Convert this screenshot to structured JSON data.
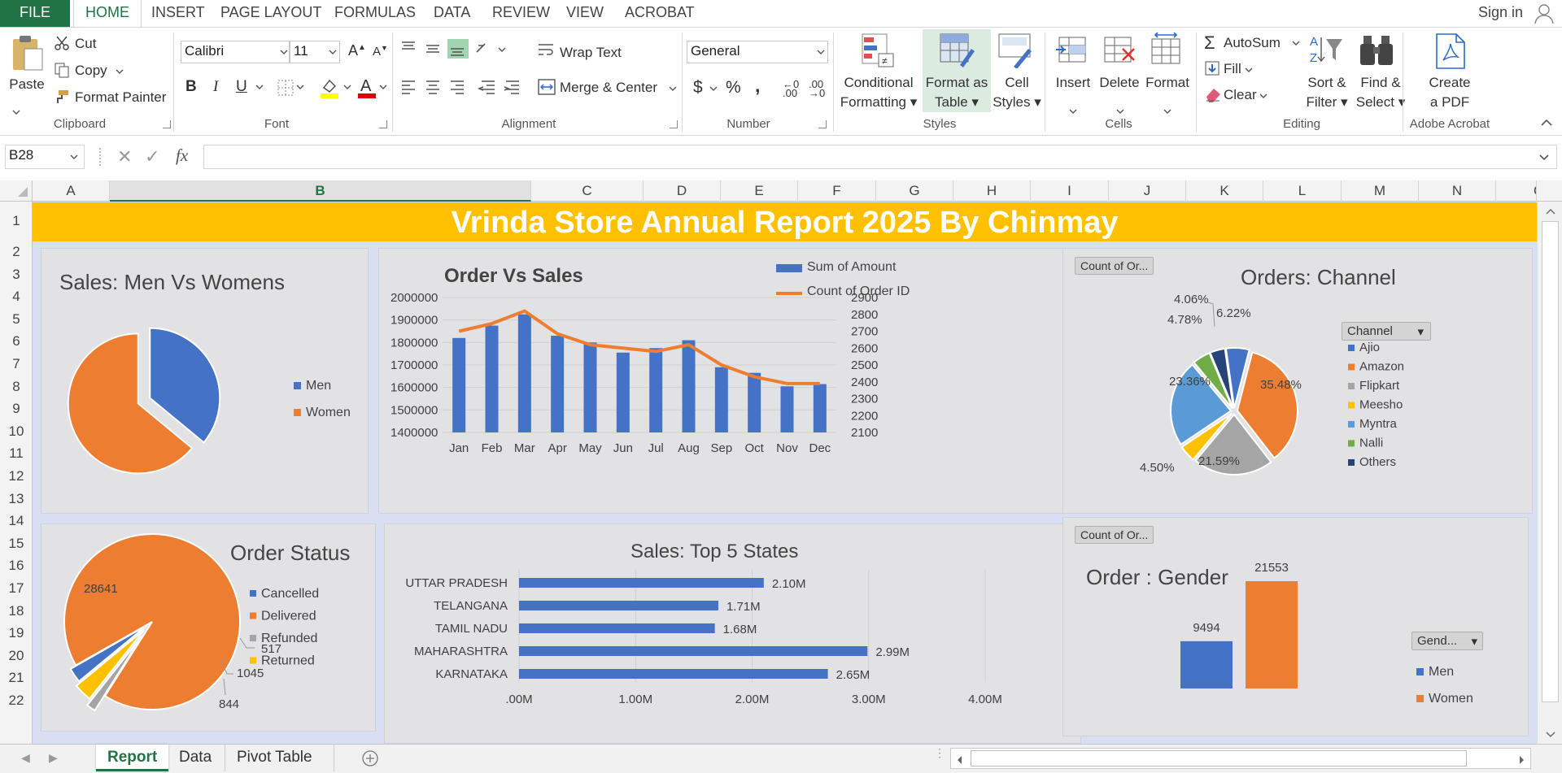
{
  "ribbon_tabs": [
    "FILE",
    "HOME",
    "INSERT",
    "PAGE LAYOUT",
    "FORMULAS",
    "DATA",
    "REVIEW",
    "VIEW",
    "ACROBAT"
  ],
  "signin": "Sign in",
  "clipboard": {
    "paste": "Paste",
    "cut": "Cut",
    "copy": "Copy",
    "format_painter": "Format Painter",
    "label": "Clipboard"
  },
  "font": {
    "name": "Calibri",
    "size": "11",
    "bold": "B",
    "italic": "I",
    "underline": "U",
    "label": "Font"
  },
  "alignment": {
    "wrap": "Wrap Text",
    "merge": "Merge & Center",
    "label": "Alignment"
  },
  "number": {
    "format": "General",
    "currency": "$",
    "percent": "%",
    "comma": ",",
    "label": "Number"
  },
  "styles": {
    "cond1": "Conditional",
    "cond2": "Formatting",
    "fat1": "Format as",
    "fat2": "Table",
    "cs1": "Cell",
    "cs2": "Styles",
    "label": "Styles"
  },
  "cells": {
    "insert": "Insert",
    "delete": "Delete",
    "format": "Format",
    "label": "Cells"
  },
  "editing": {
    "autosum": "AutoSum",
    "fill": "Fill",
    "clear": "Clear",
    "sort1": "Sort &",
    "sort2": "Filter",
    "find1": "Find &",
    "find2": "Select",
    "label": "Editing"
  },
  "acrobat": {
    "create1": "Create",
    "create2": "a PDF",
    "label": "Adobe Acrobat"
  },
  "namebox": "B28",
  "fx": "fx",
  "columns": [
    "A",
    "B",
    "C",
    "D",
    "E",
    "F",
    "G",
    "H",
    "I",
    "J",
    "K",
    "L",
    "M",
    "N",
    "O"
  ],
  "rows": [
    "1",
    "2",
    "3",
    "4",
    "5",
    "6",
    "7",
    "8",
    "9",
    "10",
    "11",
    "12",
    "13",
    "14",
    "15",
    "16",
    "17",
    "18",
    "19",
    "20",
    "21",
    "22"
  ],
  "banner": "Vrinda Store Annual Report 2025 By Chinmay",
  "sheet_tabs": [
    "Report",
    "Data",
    "Pivot Table"
  ],
  "colors": {
    "excel_green": "#217346",
    "blue": "#4472c4",
    "orange": "#ed7d31",
    "gray": "#a5a5a5",
    "yellow": "#ffc000",
    "lightblue": "#5b9bd5",
    "green": "#70ad47",
    "navy": "#264478",
    "banner": "#ffc000"
  },
  "chart_data": [
    {
      "type": "pie",
      "title": "Sales: Men Vs Womens",
      "categories": [
        "Men",
        "Women"
      ],
      "values": [
        36,
        64
      ],
      "value_labels": []
    },
    {
      "type": "bar",
      "title": "Order Vs Sales",
      "categories": [
        "Jan",
        "Feb",
        "Mar",
        "Apr",
        "May",
        "Jun",
        "Jul",
        "Aug",
        "Sep",
        "Oct",
        "Nov",
        "Dec"
      ],
      "series": [
        {
          "name": "Sum of Amount",
          "chart": "bar",
          "axis": "left",
          "values": [
            1820000,
            1875000,
            1925000,
            1830000,
            1800000,
            1755000,
            1775000,
            1810000,
            1690000,
            1665000,
            1605000,
            1615000
          ]
        },
        {
          "name": "Count of Order ID",
          "chart": "line",
          "axis": "right",
          "values": [
            2700,
            2745,
            2820,
            2685,
            2620,
            2600,
            2580,
            2620,
            2500,
            2430,
            2390,
            2390
          ]
        }
      ],
      "y_left": {
        "min": 1400000,
        "max": 2000000,
        "ticks": [
          "1400000",
          "1500000",
          "1600000",
          "1700000",
          "1800000",
          "1900000",
          "2000000"
        ]
      },
      "y_right": {
        "min": 2100,
        "max": 2900,
        "ticks": [
          "2100",
          "2200",
          "2300",
          "2400",
          "2500",
          "2600",
          "2700",
          "2800",
          "2900"
        ]
      }
    },
    {
      "type": "pie",
      "title": "Orders:  Channel",
      "filter_button": "Count of Or...",
      "legend_title": "Channel",
      "categories": [
        "Ajio",
        "Amazon",
        "Flipkart",
        "Meesho",
        "Myntra",
        "Nalli",
        "Others"
      ],
      "values": [
        6.22,
        35.48,
        21.59,
        4.5,
        23.36,
        4.78,
        4.06
      ],
      "value_labels": [
        "6.22%",
        "35.48%",
        "21.59%",
        "4.50%",
        "23.36%",
        "4.78%",
        "4.06%"
      ]
    },
    {
      "type": "pie",
      "title": "Order Status",
      "categories": [
        "Cancelled",
        "Delivered",
        "Refunded",
        "Returned"
      ],
      "values": [
        844,
        28641,
        517,
        1045
      ],
      "value_labels": [
        "844",
        "28641",
        "517",
        "1045"
      ]
    },
    {
      "type": "bar",
      "orientation": "horizontal",
      "title": "Sales: Top 5 States",
      "categories": [
        "UTTAR PRADESH",
        "TELANGANA",
        "TAMIL NADU",
        "MAHARASHTRA",
        "KARNATAKA"
      ],
      "values": [
        2.1,
        1.71,
        1.68,
        2.99,
        2.65
      ],
      "value_labels": [
        "2.10M",
        "1.71M",
        "1.68M",
        "2.99M",
        "2.65M"
      ],
      "x_ticks": [
        ".00M",
        "1.00M",
        "2.00M",
        "3.00M",
        "4.00M"
      ],
      "xlim": [
        0,
        4
      ]
    },
    {
      "type": "bar",
      "title": "Order : Gender",
      "filter_button": "Count of Or...",
      "legend_title": "Gend...",
      "categories": [
        "Men",
        "Women"
      ],
      "values": [
        9494,
        21553
      ],
      "value_labels": [
        "9494",
        "21553"
      ]
    }
  ]
}
